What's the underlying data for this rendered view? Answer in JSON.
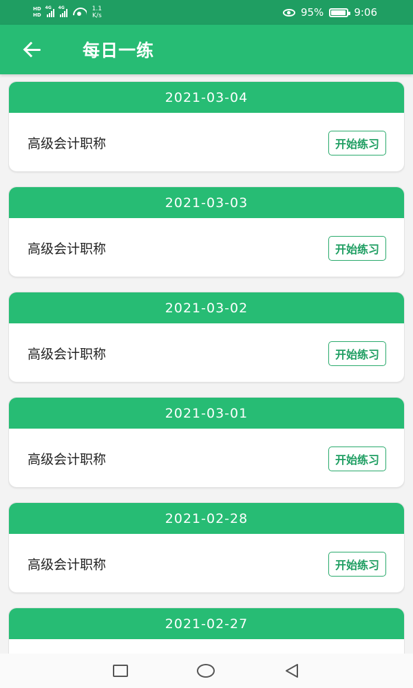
{
  "status": {
    "hd1": "HD",
    "hd2": "HD",
    "net1": "4G",
    "net2": "4G",
    "speed_value": "1.1",
    "speed_unit": "K/s",
    "battery_percent": "95%",
    "battery_level": 0.95,
    "time": "9:06"
  },
  "header": {
    "title": "每日一练"
  },
  "cards": [
    {
      "date": "2021-03-04",
      "course": "高级会计职称",
      "button": "开始练习"
    },
    {
      "date": "2021-03-03",
      "course": "高级会计职称",
      "button": "开始练习"
    },
    {
      "date": "2021-03-02",
      "course": "高级会计职称",
      "button": "开始练习"
    },
    {
      "date": "2021-03-01",
      "course": "高级会计职称",
      "button": "开始练习"
    },
    {
      "date": "2021-02-28",
      "course": "高级会计职称",
      "button": "开始练习"
    },
    {
      "date": "2021-02-27",
      "course": "",
      "button": ""
    }
  ],
  "colors": {
    "status_bar": "#1f9e62",
    "primary": "#27bc74",
    "button_text": "#1f9e62"
  },
  "icons": {
    "back": "arrow-left-icon",
    "nav_recent": "square-icon",
    "nav_home": "circle-icon",
    "nav_back": "triangle-left-icon"
  }
}
